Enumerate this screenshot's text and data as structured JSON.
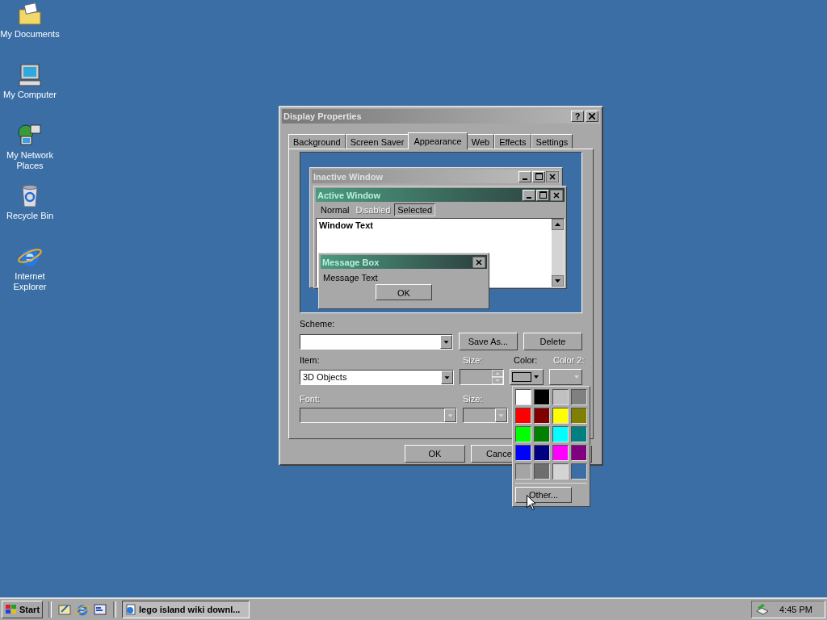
{
  "desktop_icons": [
    {
      "label": "My Documents",
      "kind": "documents"
    },
    {
      "label": "My Computer",
      "kind": "computer"
    },
    {
      "label": "My Network Places",
      "kind": "network"
    },
    {
      "label": "Recycle Bin",
      "kind": "recycle"
    },
    {
      "label": "Internet Explorer",
      "kind": "browser"
    }
  ],
  "dialog": {
    "title": "Display Properties",
    "help_label": "?",
    "tabs": [
      {
        "label": "Background",
        "selected": false
      },
      {
        "label": "Screen Saver",
        "selected": false
      },
      {
        "label": "Appearance",
        "selected": true
      },
      {
        "label": "Web",
        "selected": false
      },
      {
        "label": "Effects",
        "selected": false
      },
      {
        "label": "Settings",
        "selected": false
      }
    ],
    "preview": {
      "inactive_title": "Inactive Window",
      "active_title": "Active Window",
      "menu": [
        {
          "label": "Normal",
          "disabled": false,
          "selected": false
        },
        {
          "label": "Disabled",
          "disabled": true,
          "selected": false
        },
        {
          "label": "Selected",
          "disabled": false,
          "selected": true
        }
      ],
      "window_text": "Window Text",
      "message_box": {
        "title": "Message Box",
        "text": "Message Text",
        "button": "OK"
      }
    },
    "scheme": {
      "label": "Scheme:",
      "buttons": [
        "Save As...",
        "Delete"
      ]
    },
    "fields": [
      {
        "label": "Item:",
        "kind": "combo",
        "value": "3D Objects",
        "disabled": false
      },
      {
        "label": "Size:",
        "kind": "spin",
        "disabled": true
      },
      {
        "label": "Color:",
        "kind": "color",
        "disabled": false
      },
      {
        "label": "Color 2:",
        "kind": "color",
        "disabled": true
      },
      {
        "label": "Font:",
        "kind": "combo",
        "disabled": true
      },
      {
        "label": "Size:",
        "kind": "smallcombo",
        "disabled": true
      }
    ],
    "buttons": [
      "OK",
      "Cance"
    ]
  },
  "color_popup": {
    "swatches": [
      {
        "color": "#ffffff"
      },
      {
        "color": "#000000"
      },
      {
        "color": "#c0c0c0"
      },
      {
        "color": "#808080"
      },
      {
        "color": "#ff0000"
      },
      {
        "color": "#800000"
      },
      {
        "color": "#ffff00"
      },
      {
        "color": "#808000"
      },
      {
        "color": "#00ff00"
      },
      {
        "color": "#008000"
      },
      {
        "color": "#00ffff"
      },
      {
        "color": "#008080"
      },
      {
        "color": "#0000ff"
      },
      {
        "color": "#000080"
      },
      {
        "color": "#ff00ff"
      },
      {
        "color": "#800080"
      },
      {
        "color": "#a4a4a4"
      },
      {
        "color": "#6e6e6e"
      },
      {
        "color": "#d4d4d4"
      },
      {
        "color": "#3a6ea5"
      }
    ],
    "other_button": "Other..."
  },
  "taskbar": {
    "start": "Start",
    "quick_launch": [
      {
        "kind": "desktop"
      },
      {
        "kind": "browser"
      },
      {
        "kind": "channels"
      }
    ],
    "task": "lego island wiki downl...",
    "clock": "4:45 PM"
  }
}
